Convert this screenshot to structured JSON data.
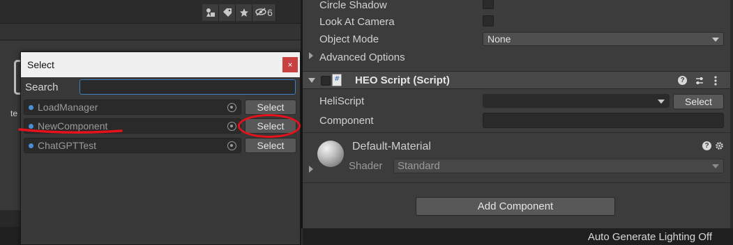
{
  "scene_toolbar": {
    "hidden_count": "6",
    "icons": [
      "shapes-icon",
      "tag-icon",
      "star-icon",
      "visibility-off-icon"
    ]
  },
  "scene": {
    "partial_text": "te"
  },
  "select_dialog": {
    "title": "Select",
    "close_glyph": "×",
    "search_label": "Search",
    "search_value": "",
    "items": [
      {
        "name": "LoadManager",
        "button": "Select"
      },
      {
        "name": "NewComponent",
        "button": "Select"
      },
      {
        "name": "ChatGPTTest",
        "button": "Select"
      }
    ],
    "annotation_color": "#e5111b"
  },
  "inspector": {
    "circle_shadow_label": "Circle Shadow",
    "look_at_camera_label": "Look At Camera",
    "object_mode_label": "Object Mode",
    "object_mode_value": "None",
    "advanced_options_label": "Advanced Options",
    "component": {
      "title": "HEO Script (Script)",
      "heliscript_label": "HeliScript",
      "heliscript_value": "",
      "heliscript_button": "Select",
      "component_label": "Component",
      "component_value": ""
    },
    "material": {
      "name": "Default-Material",
      "shader_label": "Shader",
      "shader_value": "Standard"
    },
    "add_component_label": "Add Component"
  },
  "status_bar": {
    "text": "Auto Generate Lighting Off"
  },
  "colors": {
    "accent_blue": "#3d7fbf",
    "close_red": "#c94040",
    "annotation_red": "#e5111b"
  }
}
